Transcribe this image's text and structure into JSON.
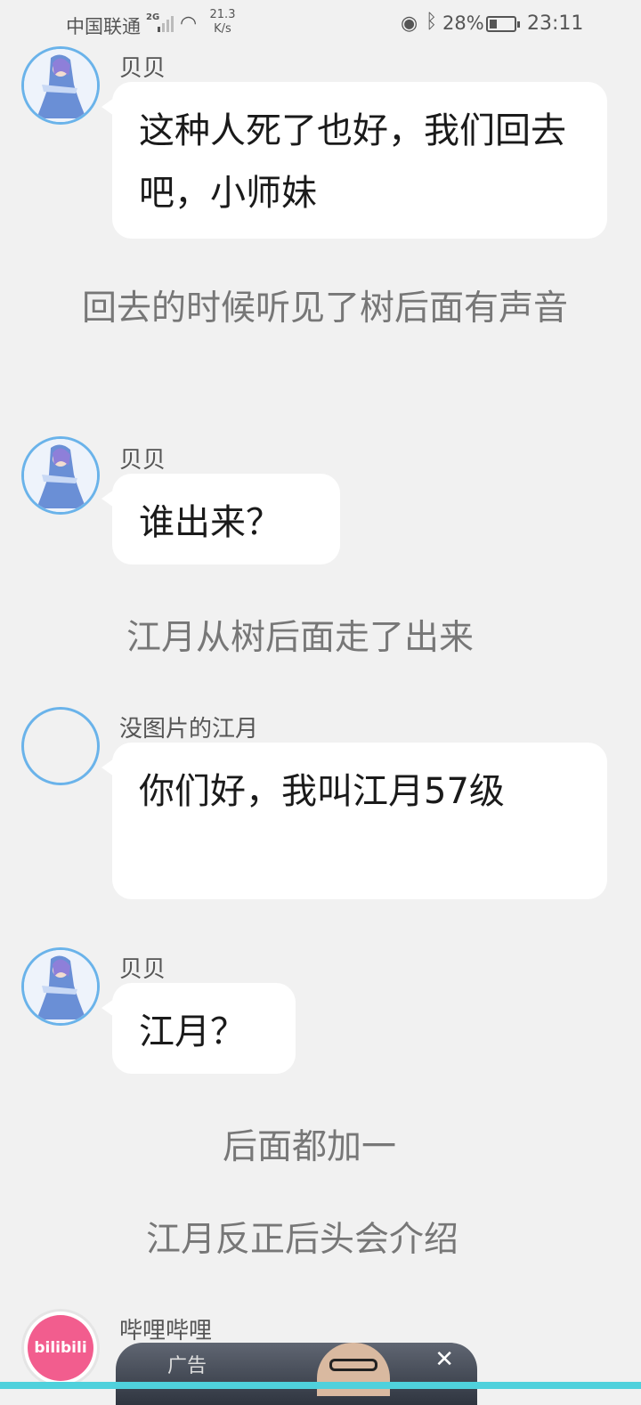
{
  "status_bar": {
    "carrier": "中国联通",
    "network": "2G",
    "speed": "21.3\nK/s",
    "battery": "28%",
    "time": "23:11"
  },
  "messages": [
    {
      "sender": "贝贝",
      "text": "这种人死了也好，我们回去吧，小师妹"
    },
    {
      "narration": "回去的时候听见了树后面有声音"
    },
    {
      "sender": "贝贝",
      "text": "谁出来？"
    },
    {
      "narration": "江月从树后面走了出来"
    },
    {
      "sender": "没图片的江月",
      "text": "你们好，我叫江月57级"
    },
    {
      "sender": "贝贝",
      "text": "江月？"
    },
    {
      "narration": "后面都加一"
    },
    {
      "narration": "江月反正后头会介绍"
    },
    {
      "sender": "哔哩哔哩",
      "avatar_text": "bilibili",
      "ad_label": "广告"
    }
  ],
  "icons": {
    "signal": "signal-icon",
    "wifi": "wifi-icon",
    "eye": "eye-icon",
    "bluetooth": "bluetooth-icon",
    "battery": "battery-icon",
    "close": "close-icon"
  },
  "colors": {
    "background": "#f1f1f1",
    "avatar_border": "#6ab3ea",
    "bilibili_pink": "#f25d8e",
    "accent_strip": "#4fd1dc"
  }
}
